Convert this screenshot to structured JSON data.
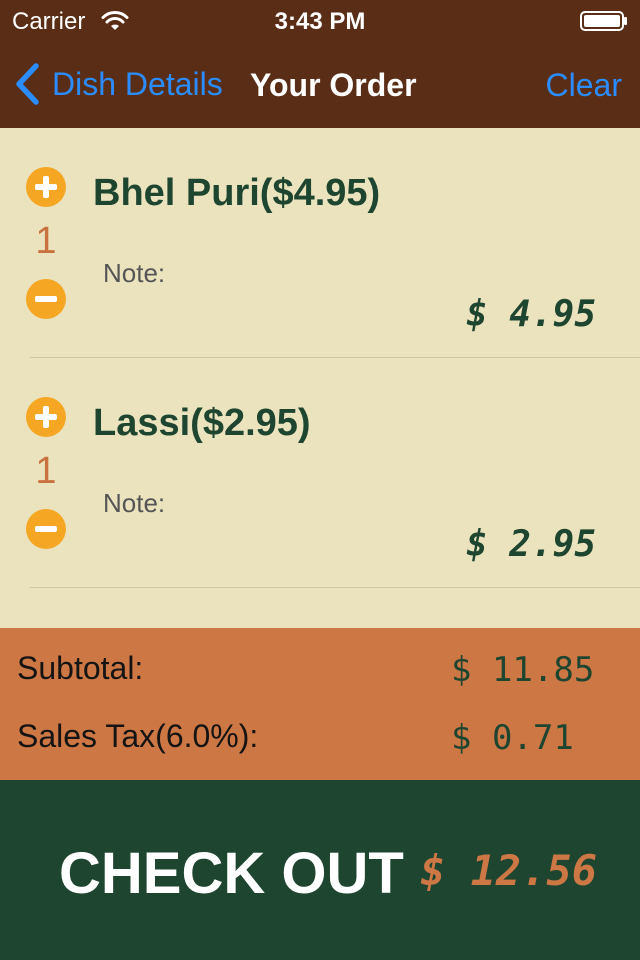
{
  "status_bar": {
    "carrier": "Carrier",
    "time": "3:43 PM",
    "icons": [
      "wifi-icon",
      "battery-icon"
    ]
  },
  "nav": {
    "back_label": "Dish Details",
    "title": "Your Order",
    "clear_label": "Clear",
    "back_icon": "chevron-left-icon"
  },
  "order_items": [
    {
      "name": "Bhel Puri($4.95)",
      "quantity": "1",
      "note_label": "Note:",
      "price": "$ 4.95"
    },
    {
      "name": "Lassi($2.95)",
      "quantity": "1",
      "note_label": "Note:",
      "price": "$ 2.95"
    }
  ],
  "totals": {
    "subtotal_label": "Subtotal:",
    "subtotal_value": "$ 11.85",
    "tax_label": "Sales Tax(6.0%):",
    "tax_value": "$ 0.71"
  },
  "checkout": {
    "label": "CHECK OUT",
    "total": "$ 12.56"
  },
  "colors": {
    "header_bg": "#5a2e16",
    "list_bg": "#ebe3bd",
    "accent_blue": "#2a8cff",
    "stepper_orange": "#f5a623",
    "totals_bg": "#cd7744",
    "checkout_bg": "#1e4530"
  }
}
